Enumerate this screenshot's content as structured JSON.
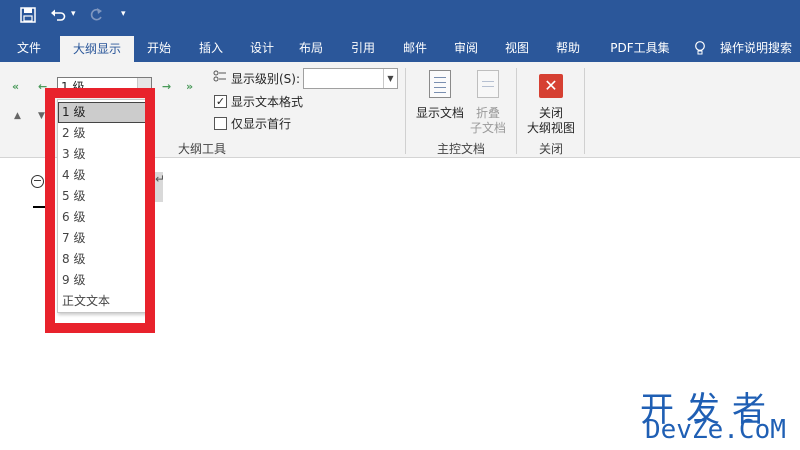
{
  "quick_access": {
    "save_icon": "save-icon",
    "undo_icon": "undo-icon",
    "redo_icon": "redo-icon",
    "customize_icon": "customize-icon"
  },
  "tabs": [
    {
      "label": "文件"
    },
    {
      "label": "大纲显示",
      "active": true
    },
    {
      "label": "开始"
    },
    {
      "label": "插入"
    },
    {
      "label": "设计"
    },
    {
      "label": "布局"
    },
    {
      "label": "引用"
    },
    {
      "label": "邮件"
    },
    {
      "label": "审阅"
    },
    {
      "label": "视图"
    },
    {
      "label": "帮助"
    },
    {
      "label": "PDF工具集"
    }
  ],
  "tell_me": "操作说明搜索",
  "outline_tools": {
    "level_value": "1 级",
    "show_level_label": "显示级别(S):",
    "show_level_value": "",
    "show_text_format_label": "显示文本格式",
    "show_text_format_checked": true,
    "show_first_line_label": "仅显示首行",
    "show_first_line_checked": false,
    "group_label": "大纲工具"
  },
  "master_document": {
    "show_document_label": "显示文档",
    "collapse_subdocs_label_1": "折叠",
    "collapse_subdocs_label_2": "子文档",
    "group_label": "主控文档"
  },
  "close_group": {
    "close_label_1": "关闭",
    "close_label_2": "大纲视图",
    "group_label": "关闭"
  },
  "level_dropdown": {
    "items": [
      "1 级",
      "2 级",
      "3 级",
      "4 级",
      "5 级",
      "6 级",
      "7 级",
      "8 级",
      "9 级",
      "正文文本"
    ],
    "selected": "1 级"
  },
  "document": {
    "paragraph_mark": "↵"
  },
  "watermark": {
    "cn": "开发者",
    "en": "DevZe.CoM"
  },
  "colors": {
    "title_bar": "#2b579a",
    "ribbon": "#f3f3f3",
    "highlight": "#e8222c",
    "watermark": "#1f5fb4"
  }
}
